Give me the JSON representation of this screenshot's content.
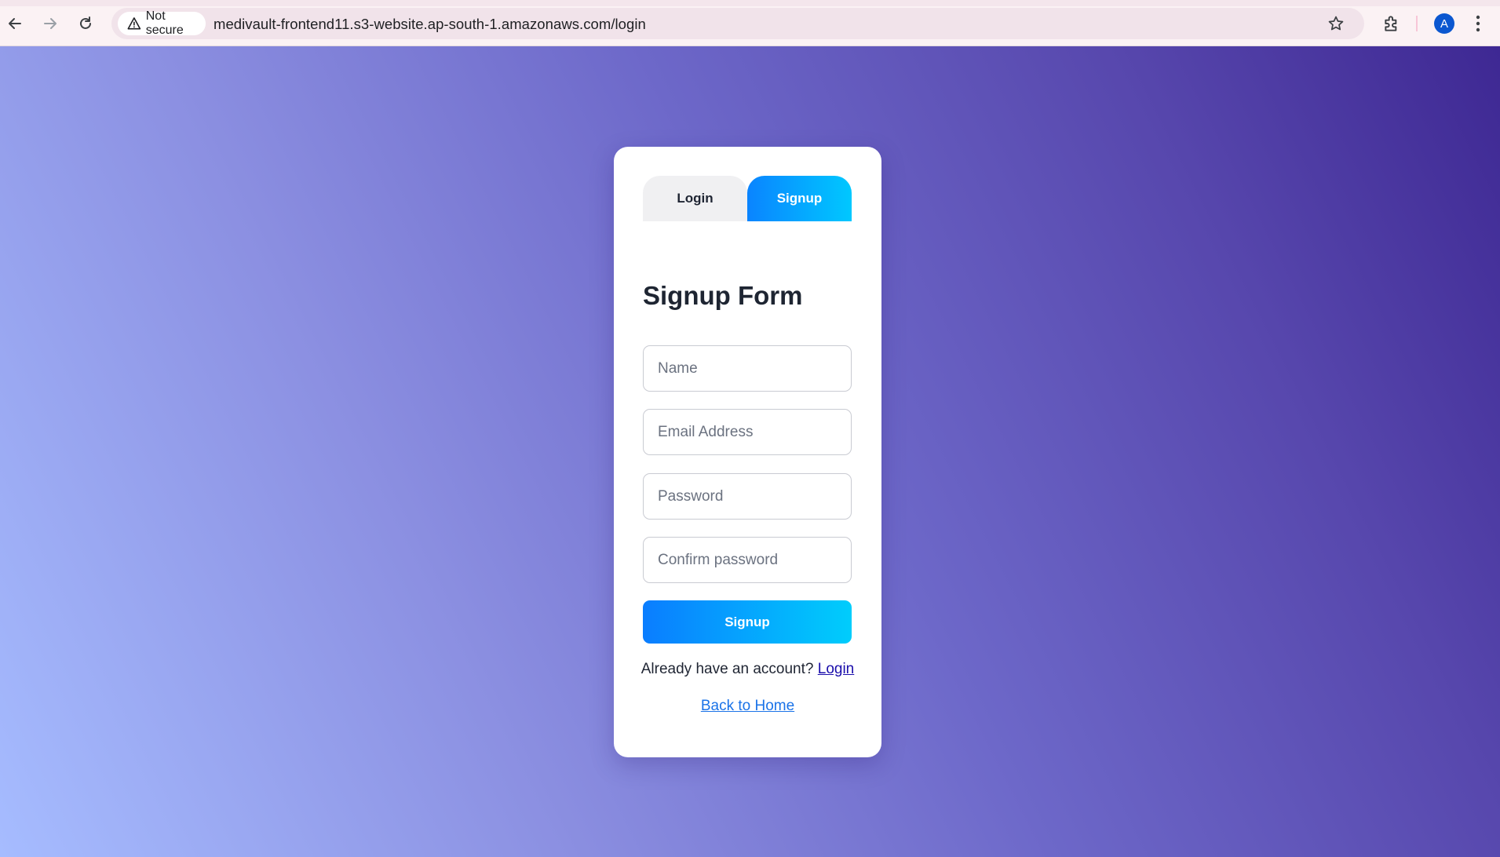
{
  "browser": {
    "security_label": "Not secure",
    "url": "medivault-frontend11.s3-website.ap-south-1.amazonaws.com/login",
    "profile_initial": "A",
    "icons": [
      "back-icon",
      "forward-icon",
      "reload-icon",
      "warning-icon",
      "star-icon",
      "extensions-icon",
      "kebab-menu-icon"
    ]
  },
  "tabs": {
    "login_label": "Login",
    "signup_label": "Signup",
    "active": "Signup"
  },
  "form": {
    "title": "Signup Form",
    "name_placeholder": "Name",
    "email_placeholder": "Email Address",
    "password_placeholder": "Password",
    "confirm_placeholder": "Confirm password",
    "submit_label": "Signup"
  },
  "footer": {
    "account_prompt": "Already have an account?",
    "login_link": "Login",
    "home_link": "Back to Home"
  },
  "colors": {
    "accent_start": "#0a84ff",
    "accent_end": "#00c8ff",
    "bg_dark": "#3e2893",
    "bg_light": "#a6bcff"
  }
}
